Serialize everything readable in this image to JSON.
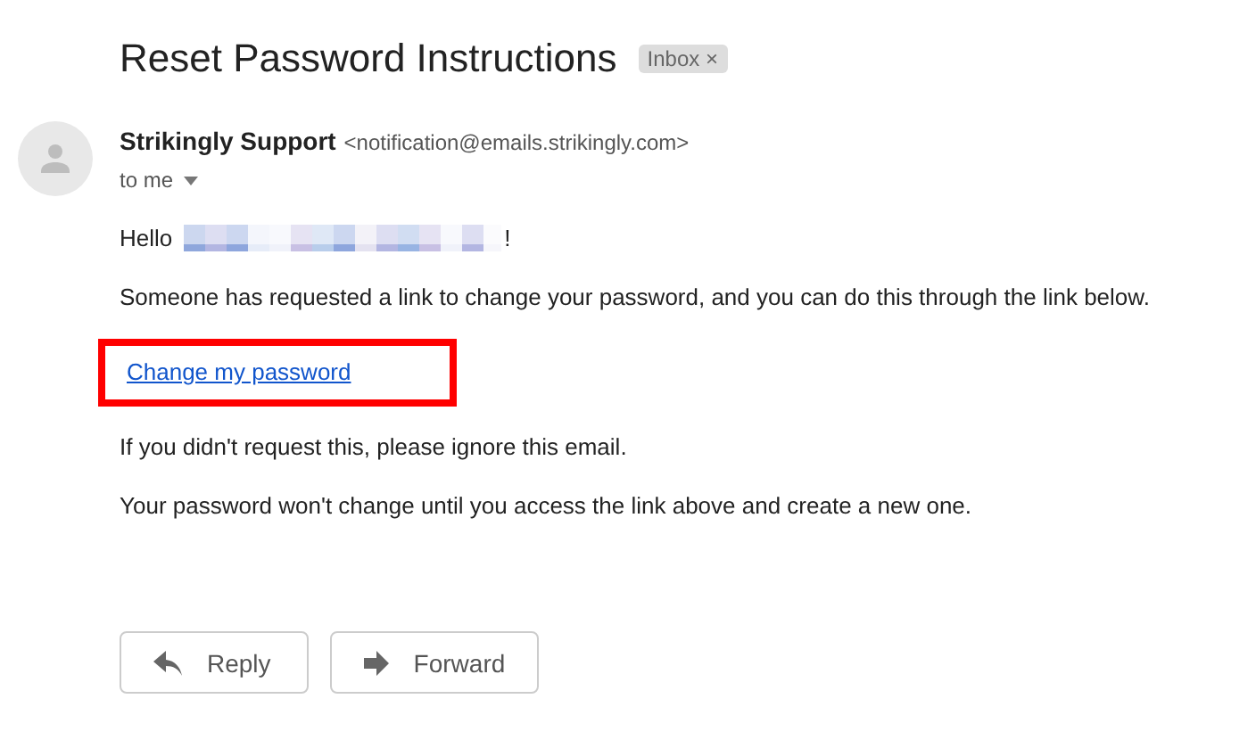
{
  "subject": "Reset Password Instructions",
  "label": {
    "text": "Inbox",
    "close": "×"
  },
  "sender": {
    "name": "Strikingly Support",
    "email": "<notification@emails.strikingly.com>",
    "recipient": "to me"
  },
  "body": {
    "greeting": "Hello",
    "greeting_end": "!",
    "request": "Someone has requested a link to change your password, and you can do this through the link below.",
    "link": "Change my password",
    "link_highlighted": true,
    "ignore": "If you didn't request this, please ignore this email.",
    "notice": "Your password won't change until you access the link above and create a new one."
  },
  "actions": [
    {
      "kind": "reply",
      "label": "Reply"
    },
    {
      "kind": "forward",
      "label": "Forward"
    }
  ]
}
